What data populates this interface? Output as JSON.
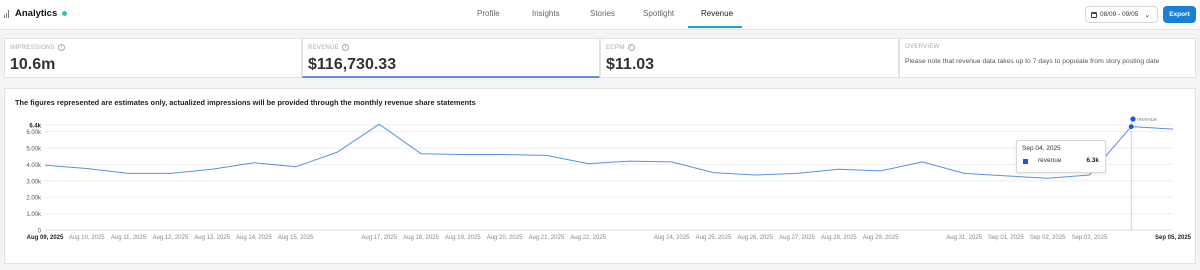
{
  "app": {
    "title": "Analytics"
  },
  "tabs": [
    {
      "label": "Profile"
    },
    {
      "label": "Insights"
    },
    {
      "label": "Stories"
    },
    {
      "label": "Spotlight"
    },
    {
      "label": "Revenue",
      "active": true
    }
  ],
  "toolbar": {
    "date_range": "08/09 - 09/05",
    "export_label": "Export"
  },
  "metrics": {
    "impressions": {
      "label": "IMPRESSIONS",
      "value": "10.6m"
    },
    "revenue": {
      "label": "REVENUE",
      "value": "$116,730.33"
    },
    "ecpm": {
      "label": "ECPM",
      "value": "$11.03"
    },
    "overview": {
      "label": "OVERVIEW",
      "text": "Please note that revenue data takes up to 7 days to populate from story posting date"
    }
  },
  "chart_heading": "The figures represented are estimates only, actualized impressions will be provided through the monthly revenue share statements",
  "tooltip": {
    "date": "Sep 04, 2025",
    "series": "revenue",
    "value": "6.3k"
  },
  "colors": {
    "accent": "#1c9fd8",
    "line": "#5b8ee6",
    "marker": "#1b57d8",
    "export": "#1c7fd6"
  },
  "chart_data": {
    "type": "line",
    "series": [
      {
        "name": "revenue",
        "x": [
          "Aug 09, 2025",
          "Aug 10, 2025",
          "Aug 11, 2025",
          "Aug 12, 2025",
          "Aug 13, 2025",
          "Aug 14, 2025",
          "Aug 15, 2025",
          "Aug 16, 2025",
          "Aug 17, 2025",
          "Aug 18, 2025",
          "Aug 19, 2025",
          "Aug 20, 2025",
          "Aug 21, 2025",
          "Aug 22, 2025",
          "Aug 23, 2025",
          "Aug 24, 2025",
          "Aug 25, 2025",
          "Aug 26, 2025",
          "Aug 27, 2025",
          "Aug 28, 2025",
          "Aug 29, 2025",
          "Aug 30, 2025",
          "Aug 31, 2025",
          "Sep 01, 2025",
          "Sep 02, 2025",
          "Sep 03, 2025",
          "Sep 04, 2025",
          "Sep 05, 2025"
        ],
        "values": [
          3950,
          3750,
          3450,
          3450,
          3700,
          4100,
          3850,
          4750,
          6450,
          4650,
          4600,
          4600,
          4550,
          4050,
          4200,
          4150,
          3500,
          3350,
          3450,
          3700,
          3600,
          4150,
          3450,
          3300,
          3150,
          3350,
          6300,
          6150
        ]
      }
    ],
    "x_tick_labels": [
      "Aug 09, 2025",
      "Aug 10, 2025",
      "Aug 11, 2025",
      "Aug 12, 2025",
      "Aug 13, 2025",
      "Aug 14, 2025",
      "Aug 15, 2025",
      "Aug 17, 2025",
      "Aug 18, 2025",
      "Aug 19, 2025",
      "Aug 20, 2025",
      "Aug 21, 2025",
      "Aug 22, 2025",
      "Aug 24, 2025",
      "Aug 25, 2025",
      "Aug 26, 2025",
      "Aug 27, 2025",
      "Aug 28, 2025",
      "Aug 29, 2025",
      "Aug 31, 2025",
      "Sep 01, 2025",
      "Sep 02, 2025",
      "Sep 03, 2025",
      "Sep 05, 2025"
    ],
    "x_tick_bold": [
      "Aug 09, 2025",
      "Sep 05, 2025"
    ],
    "y_ticks": [
      {
        "v": 0,
        "label": "0"
      },
      {
        "v": 1000,
        "label": "1.00k"
      },
      {
        "v": 2000,
        "label": "2.00k"
      },
      {
        "v": 3000,
        "label": "3.00k"
      },
      {
        "v": 4000,
        "label": "4.00k"
      },
      {
        "v": 5000,
        "label": "5.00k"
      },
      {
        "v": 6000,
        "label": "6.00k"
      },
      {
        "v": 6400,
        "label": "6.4k"
      }
    ],
    "ylim": [
      0,
      6400
    ],
    "legend": {
      "label": "revenue",
      "position": "top-right"
    },
    "highlight": {
      "x": "Sep 04, 2025",
      "value": 6300
    },
    "grid": true
  }
}
